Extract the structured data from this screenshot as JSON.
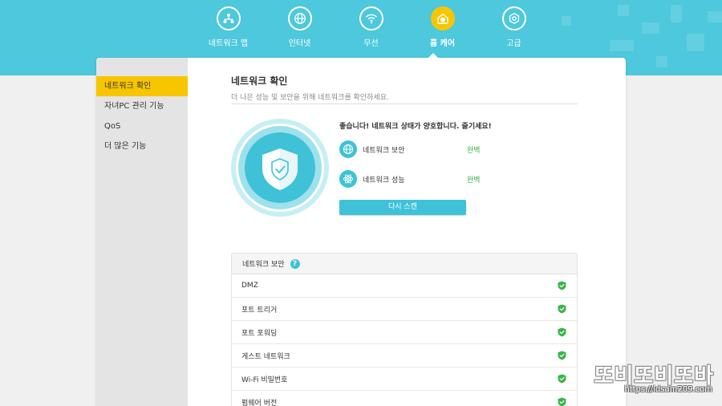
{
  "nav": {
    "items": [
      {
        "label": "네트워크 맵",
        "icon": "network-map-icon",
        "active": false
      },
      {
        "label": "인터넷",
        "icon": "globe-icon",
        "active": false
      },
      {
        "label": "무선",
        "icon": "wifi-icon",
        "active": false
      },
      {
        "label": "홈 케어",
        "icon": "home-care-icon",
        "active": true
      },
      {
        "label": "고급",
        "icon": "gear-icon",
        "active": false
      }
    ]
  },
  "sidebar": {
    "items": [
      {
        "label": "네트워크 확인",
        "active": true
      },
      {
        "label": "자녀PC 관리 기능",
        "active": false
      },
      {
        "label": "QoS",
        "active": false
      },
      {
        "label": "더 많은 기능",
        "active": false
      }
    ]
  },
  "main": {
    "title": "네트워크 확인",
    "subtitle": "더 나은 성능 및 보안을 위해 네트워크를 확인하세요.",
    "status_heading": "좋습니다! 네트워크 상태가 양호합니다. 즐기세요!",
    "status": [
      {
        "label": "네트워크 보안",
        "value": "완벽",
        "icon": "globe-icon"
      },
      {
        "label": "네트워크 성능",
        "value": "완벽",
        "icon": "atom-icon"
      }
    ],
    "rescan_label": "다시 스캔"
  },
  "security_panel": {
    "title": "네트워크 보안",
    "help_label": "?",
    "rows": [
      {
        "label": "DMZ",
        "status": "ok"
      },
      {
        "label": "포트 트리거",
        "status": "ok"
      },
      {
        "label": "포트 포워딩",
        "status": "ok"
      },
      {
        "label": "게스트 네트워크",
        "status": "ok"
      },
      {
        "label": "Wi-Fi 비밀번호",
        "status": "ok"
      },
      {
        "label": "펌웨어 버전",
        "status": "ok"
      }
    ]
  },
  "watermark": {
    "title": "또비또비또바",
    "url": "https://idsam209.com"
  },
  "colors": {
    "header": "#4dc8dc",
    "accent": "#3fc2d8",
    "active": "#f7c600",
    "ok": "#3ab54a"
  }
}
